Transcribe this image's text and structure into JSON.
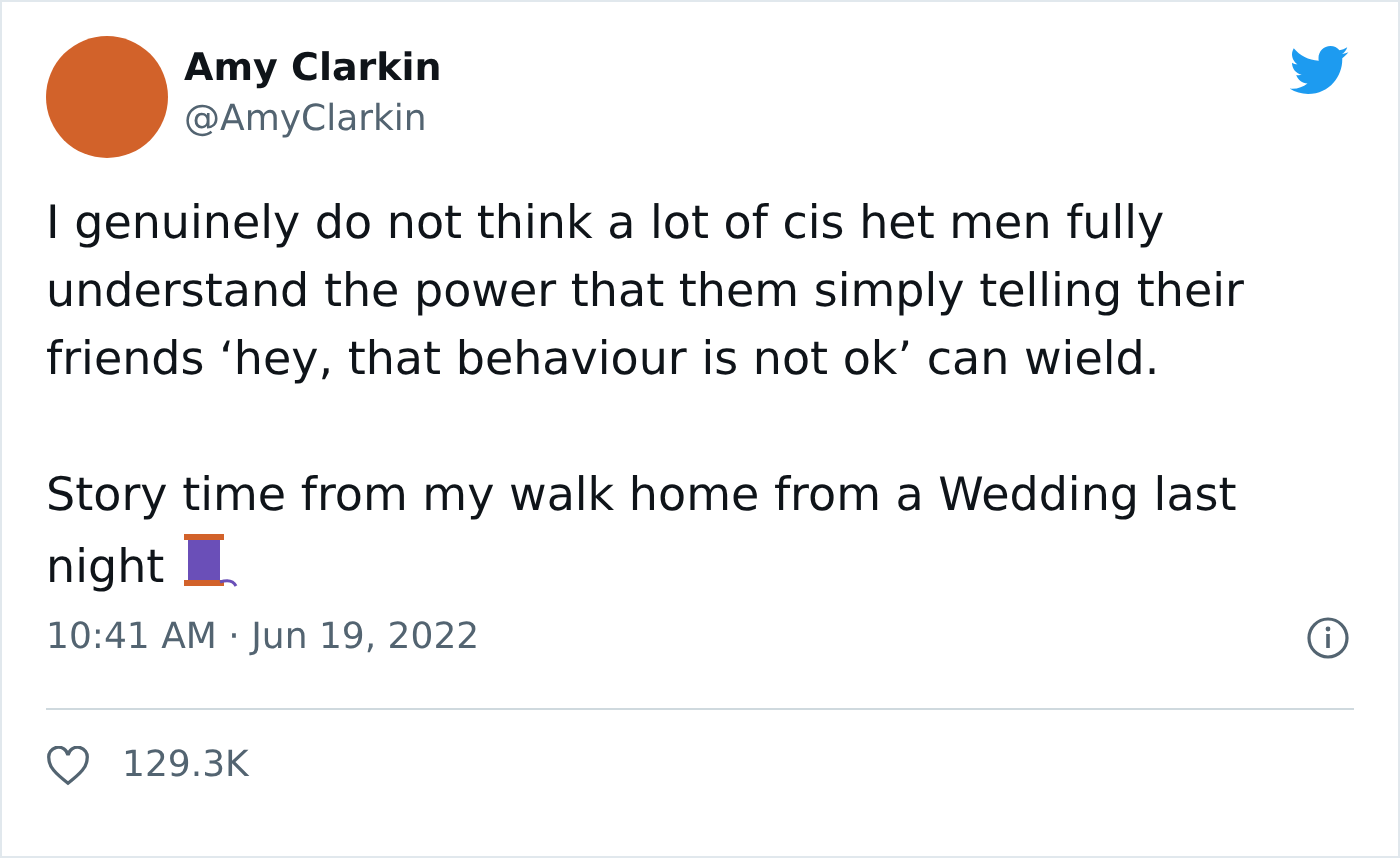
{
  "author": {
    "name": "Amy Clarkin",
    "handle": "@AmyClarkin"
  },
  "paragraphs": [
    "I genuinely do not think a lot of cis het men fully understand the power that them simply telling their friends ‘hey, that behaviour is not ok’ can wield.",
    "Story time from my walk home from a Wedding last night"
  ],
  "timestamp": "10:41 AM · Jun 19, 2022",
  "likes": "129.3K"
}
